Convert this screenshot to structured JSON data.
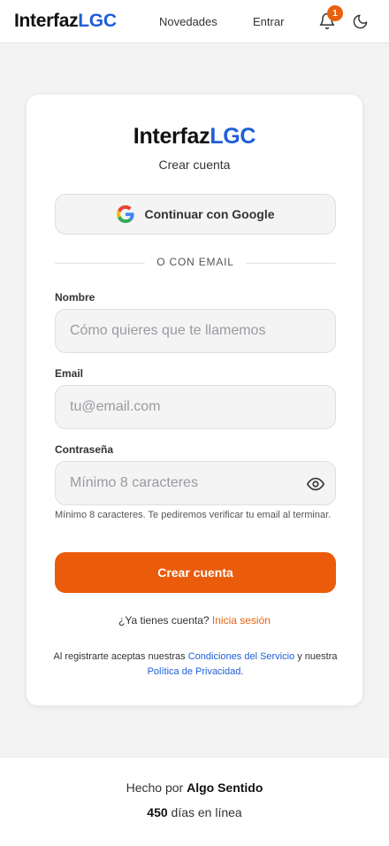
{
  "header": {
    "logo_part1": "Interfaz",
    "logo_part2": "LGC",
    "nav_novedades": "Novedades",
    "nav_entrar": "Entrar",
    "notification_count": "1",
    "icons": [
      "bell-icon",
      "moon-icon"
    ]
  },
  "card": {
    "logo_part1": "Interfaz",
    "logo_part2": "LGC",
    "subtitle": "Crear cuenta",
    "google_button": "Continuar con Google",
    "divider_text": "O CON EMAIL",
    "name_label": "Nombre",
    "name_placeholder": "Cómo quieres que te llamemos",
    "email_label": "Email",
    "email_placeholder": "tu@email.com",
    "password_label": "Contraseña",
    "password_placeholder": "Mínimo 8 caracteres",
    "password_hint": "Mínimo 8 caracteres. Te pediremos verificar tu email al terminar.",
    "submit_button": "Crear cuenta",
    "have_account": "¿Ya tienes cuenta?",
    "login_link": "Inicia sesión",
    "terms_prefix": "Al registrarte aceptas nuestras",
    "terms_link": "Condiciones del Servicio",
    "terms_and": "y nuestra",
    "privacy_link": "Política de Privacidad",
    "terms_end": "."
  },
  "footer": {
    "made_by_prefix": "Hecho por",
    "made_by_name": "Algo Sentido",
    "days_count": "450",
    "days_suffix": "días en línea"
  },
  "colors": {
    "brand_blue": "#1f5ed8",
    "accent_orange": "#ea5b0c"
  }
}
